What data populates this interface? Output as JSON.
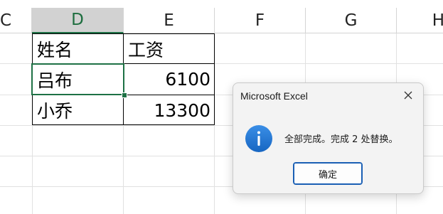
{
  "columns": {
    "c": "C",
    "d": "D",
    "e": "E",
    "f": "F",
    "g": "G",
    "h": "H"
  },
  "table": {
    "header": [
      "姓名",
      "工资"
    ],
    "rows": [
      [
        "吕布",
        "6100"
      ],
      [
        "小乔",
        "13300"
      ]
    ]
  },
  "dialog": {
    "title": "Microsoft Excel",
    "message": "全部完成。完成 2 处替换。",
    "ok_label": "确定",
    "icon": "info-icon",
    "close_icon": "close-icon"
  },
  "colors": {
    "accent_green": "#1e7145",
    "info_blue": "#1a73c8",
    "button_border": "#1a5fb4"
  }
}
